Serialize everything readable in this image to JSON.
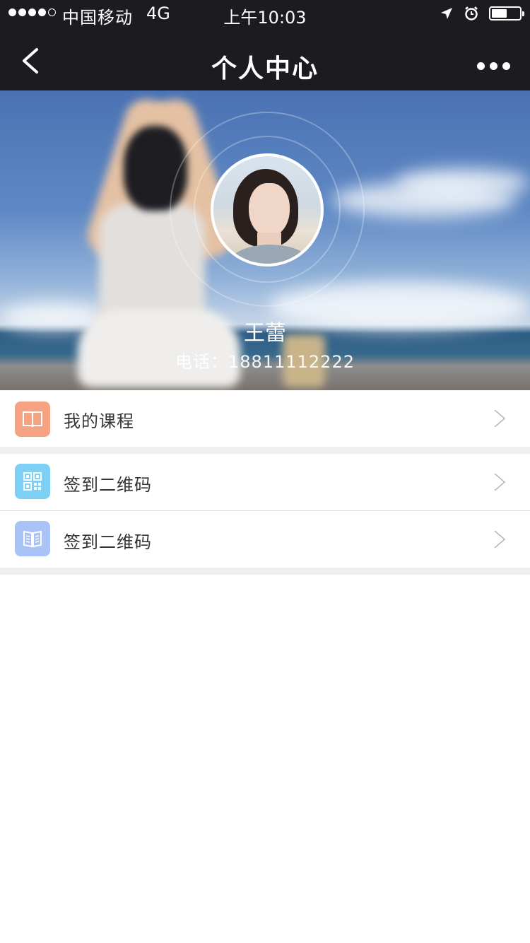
{
  "status_bar": {
    "carrier": "中国移动",
    "network": "4G",
    "time": "上午10:03",
    "signal_bars": 4,
    "signal_total": 5,
    "battery_level": 0.55
  },
  "nav": {
    "title": "个人中心",
    "back_icon": "chevron-left-icon",
    "more_icon": "more-dots-icon"
  },
  "profile": {
    "name": "王蕾",
    "phone": "电话：18811112222"
  },
  "menu": [
    {
      "label": "我的课程",
      "icon": "book-icon",
      "color": "#f5a383"
    },
    {
      "label": "签到二维码",
      "icon": "qr-code-icon",
      "color": "#7ecff5"
    },
    {
      "label": "签到二维码",
      "icon": "open-book-icon",
      "color": "#a9c3f6"
    }
  ],
  "colors": {
    "nav_background": "#1c1c20",
    "separator": "#efefef"
  }
}
